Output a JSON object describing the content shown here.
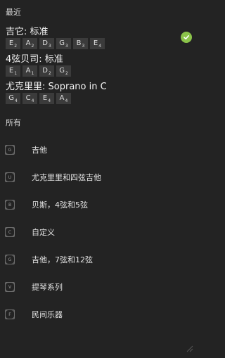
{
  "sections": {
    "recent": "最近",
    "all": "所有"
  },
  "recent": [
    {
      "title": "吉它: 标准",
      "selected": true,
      "notes": [
        {
          "n": "E",
          "o": "2"
        },
        {
          "n": "A",
          "o": "2"
        },
        {
          "n": "D",
          "o": "3"
        },
        {
          "n": "G",
          "o": "3"
        },
        {
          "n": "B",
          "o": "3"
        },
        {
          "n": "E",
          "o": "4"
        }
      ]
    },
    {
      "title": "4弦贝司: 标准",
      "notes": [
        {
          "n": "E",
          "o": "1"
        },
        {
          "n": "A",
          "o": "1"
        },
        {
          "n": "D",
          "o": "2"
        },
        {
          "n": "G",
          "o": "2"
        }
      ]
    },
    {
      "title": "尤克里里: Soprano in C",
      "notes": [
        {
          "n": "G",
          "o": "4"
        },
        {
          "n": "C",
          "o": "4"
        },
        {
          "n": "E",
          "o": "4"
        },
        {
          "n": "A",
          "o": "4"
        }
      ]
    }
  ],
  "categories": [
    {
      "icon_letter": "G",
      "label": "吉他"
    },
    {
      "icon_letter": "U",
      "label": "尤克里里和四弦吉他"
    },
    {
      "icon_letter": "B",
      "label": "贝斯，4弦和5弦"
    },
    {
      "icon_letter": "C",
      "label": "自定义"
    },
    {
      "icon_letter": "G",
      "label": "吉他，7弦和12弦"
    },
    {
      "icon_letter": "V",
      "label": "提琴系列"
    },
    {
      "icon_letter": "F",
      "label": "民间乐器"
    }
  ],
  "colors": {
    "accent": "#8bc34a",
    "background": "#232323",
    "chip": "#3b3b3b"
  }
}
